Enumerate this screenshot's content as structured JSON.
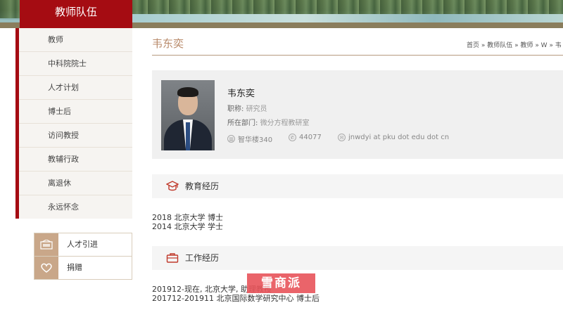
{
  "sidebar": {
    "title": "教师队伍",
    "items": [
      {
        "label": "教师"
      },
      {
        "label": "中科院院士"
      },
      {
        "label": "人才计划"
      },
      {
        "label": "博士后"
      },
      {
        "label": "访问教授"
      },
      {
        "label": "教辅行政"
      },
      {
        "label": "离退休"
      },
      {
        "label": "永远怀念"
      }
    ],
    "quick_links": [
      {
        "label": "人才引进",
        "icon": "job-board-icon"
      },
      {
        "label": "捐赠",
        "icon": "heart-icon"
      }
    ]
  },
  "page": {
    "title": "韦东奕",
    "breadcrumb": "首页 » 教师队伍 » 教师 » W » 韦"
  },
  "profile": {
    "name": "韦东奕",
    "title_label": "职称:",
    "title_value": "研究员",
    "dept_label": "所在部门:",
    "dept_value": "微分方程教研室",
    "office": "智华楼340",
    "phone": "44077",
    "email": "jnwdyi at pku dot edu dot cn"
  },
  "education": {
    "heading": "教育经历",
    "lines": [
      "2018 北京大学 博士",
      "2014 北京大学 学士"
    ]
  },
  "work": {
    "heading": "工作经历",
    "lines": [
      "201912-现在, 北京大学, 助理教授",
      "201712-201911 北京国际数学研究中心 博士后"
    ]
  },
  "watermark": "雪商派",
  "colors": {
    "accent": "#a50c12",
    "title": "#b88a6a",
    "icon_red": "#c0392b"
  }
}
